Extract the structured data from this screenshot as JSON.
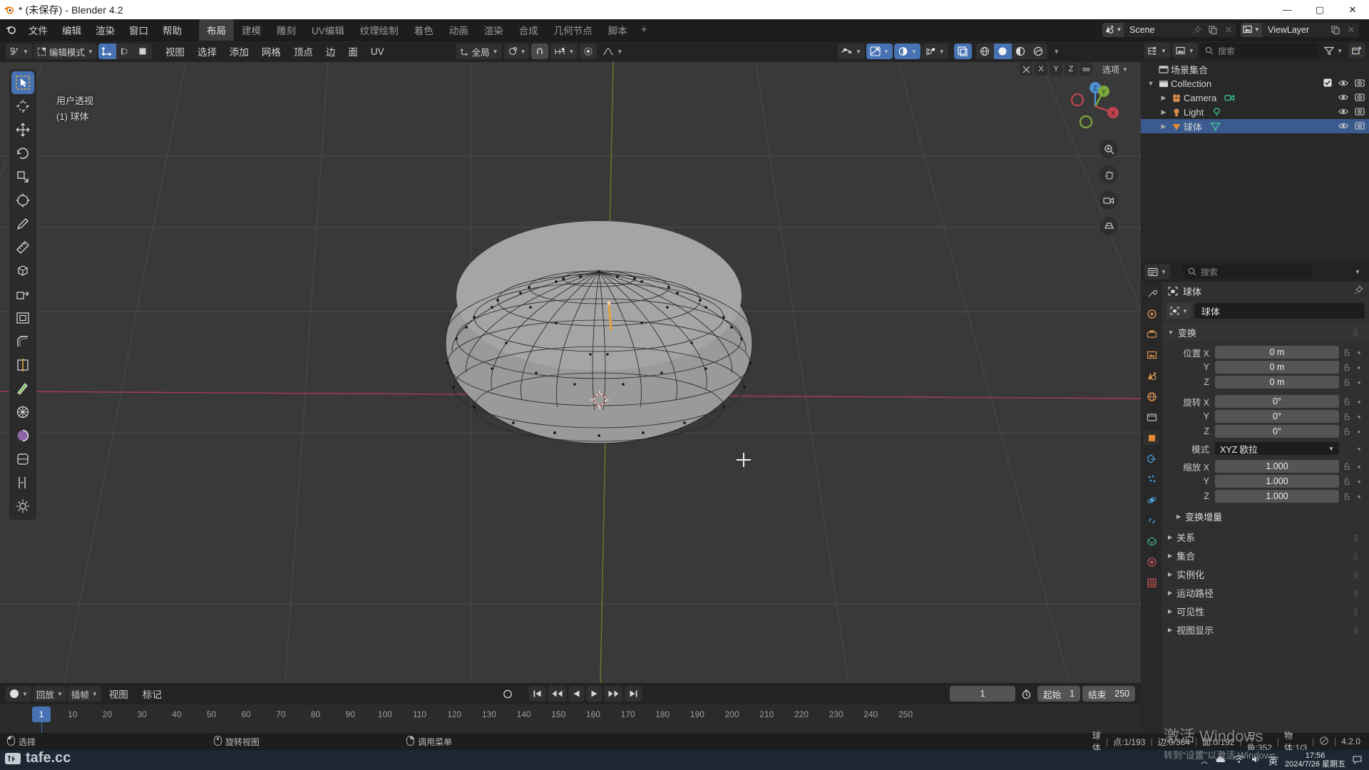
{
  "window": {
    "title": "* (未保存) - Blender 4.2",
    "minimize": "—",
    "maximize": "▢",
    "close": "✕"
  },
  "topbar": {
    "menus": [
      "文件",
      "编辑",
      "渲染",
      "窗口",
      "帮助"
    ],
    "workspaces": [
      {
        "label": "布局",
        "active": true
      },
      {
        "label": "建模",
        "active": false
      },
      {
        "label": "雕刻",
        "active": false
      },
      {
        "label": "UV编辑",
        "active": false
      },
      {
        "label": "纹理绘制",
        "active": false
      },
      {
        "label": "着色",
        "active": false
      },
      {
        "label": "动画",
        "active": false
      },
      {
        "label": "渲染",
        "active": false
      },
      {
        "label": "合成",
        "active": false
      },
      {
        "label": "几何节点",
        "active": false
      },
      {
        "label": "脚本",
        "active": false
      }
    ],
    "add_workspace": "+",
    "scene": {
      "name": "Scene",
      "icon": "scene-icon"
    },
    "view_layer": {
      "name": "ViewLayer",
      "icon": "viewlayer-icon"
    }
  },
  "viewport_header": {
    "editor_type_icon": "editor-type-icon",
    "mode": "编辑模式",
    "select_modes": [
      "vertex-select-icon",
      "edge-select-icon",
      "face-select-icon"
    ],
    "active_select_mode": 0,
    "menus": [
      "视图",
      "选择",
      "添加",
      "网格",
      "顶点",
      "边",
      "面",
      "UV"
    ],
    "transform_orientation": "全局",
    "pivot_icon": "pivot-point-icon",
    "snap_icon": "magnet-icon",
    "snap_target_icon": "snap-target-icon",
    "proportional_icon": "proportional-edit-icon",
    "falloff_icon": "falloff-curve-icon",
    "right_icons": [
      "show-gizmo-icon",
      "overlays-icon",
      "xray-icon",
      "visibility-icon",
      "shading-wireframe-icon",
      "shading-solid-icon",
      "shading-material-icon",
      "shading-rendered-icon"
    ]
  },
  "viewport": {
    "view_label": "用户透视",
    "object_label": "(1) 球体",
    "axis_gizmo": {
      "x": "X",
      "y": "Y",
      "z": "Z"
    },
    "select_mode_overlay": [
      "X",
      "Y",
      "Z",
      "选项"
    ],
    "tools": [
      {
        "name": "tweak-tool",
        "active": true
      },
      {
        "name": "cursor-tool",
        "active": false
      },
      {
        "name": "move-tool",
        "active": false
      },
      {
        "name": "rotate-tool",
        "active": false
      },
      {
        "name": "scale-tool",
        "active": false
      },
      {
        "name": "transform-tool",
        "active": false
      },
      {
        "name": "annotate-tool",
        "active": false
      },
      {
        "name": "measure-tool",
        "active": false
      },
      {
        "name": "add-cube-tool",
        "active": false
      },
      {
        "name": "extrude-region-tool",
        "active": false
      },
      {
        "name": "inset-faces-tool",
        "active": false
      },
      {
        "name": "bevel-tool",
        "active": false
      },
      {
        "name": "loop-cut-tool",
        "active": false
      },
      {
        "name": "knife-tool",
        "active": false
      },
      {
        "name": "poly-build-tool",
        "active": false
      },
      {
        "name": "spin-tool",
        "active": false
      },
      {
        "name": "smooth-tool",
        "active": false
      },
      {
        "name": "edge-slide-tool",
        "active": false
      },
      {
        "name": "shrink-fatten-tool",
        "active": false
      }
    ]
  },
  "timeline": {
    "editor_icon": "timeline-editor-icon",
    "menus": [
      "回放",
      "插帧",
      "视图",
      "标记"
    ],
    "playhead_frame": "1",
    "ticks": [
      "10",
      "20",
      "30",
      "40",
      "50",
      "60",
      "70",
      "80",
      "90",
      "100",
      "110",
      "120",
      "130",
      "140",
      "150",
      "160",
      "170",
      "180",
      "190",
      "200",
      "210",
      "220",
      "230",
      "240",
      "250"
    ],
    "current_frame": "1",
    "start_label": "起始",
    "start_value": "1",
    "end_label": "结束",
    "end_value": "250"
  },
  "outliner": {
    "display_mode_icon": "outliner-display-icon",
    "filter_icon": "filter-icon",
    "new_collection_icon": "new-collection-icon",
    "search_placeholder": "搜索",
    "root": "场景集合",
    "items": [
      {
        "label": "Collection",
        "icon": "collection-icon",
        "depth": 0,
        "expanded": true,
        "checkbox": true,
        "selected": false
      },
      {
        "label": "Camera",
        "icon": "camera-object-icon",
        "depth": 1,
        "expanded": false,
        "data_icon": "camera-data-icon",
        "selected": false
      },
      {
        "label": "Light",
        "icon": "light-object-icon",
        "depth": 1,
        "expanded": false,
        "data_icon": "light-data-icon",
        "selected": false
      },
      {
        "label": "球体",
        "icon": "mesh-object-icon",
        "depth": 1,
        "expanded": false,
        "data_icon": "mesh-data-icon",
        "selected": true
      }
    ]
  },
  "properties": {
    "editor_icon": "properties-editor-icon",
    "search_placeholder": "搜索",
    "tabs": [
      {
        "name": "tool-tab",
        "active": false
      },
      {
        "name": "render-tab",
        "active": false
      },
      {
        "name": "output-tab",
        "active": false
      },
      {
        "name": "view-layer-tab",
        "active": false
      },
      {
        "name": "scene-tab",
        "active": false
      },
      {
        "name": "world-tab",
        "active": false
      },
      {
        "name": "collection-tab",
        "active": false
      },
      {
        "name": "object-tab",
        "active": true
      },
      {
        "name": "modifier-tab",
        "active": false
      },
      {
        "name": "particles-tab",
        "active": false
      },
      {
        "name": "physics-tab",
        "active": false
      },
      {
        "name": "constraint-tab",
        "active": false
      },
      {
        "name": "data-tab",
        "active": false
      },
      {
        "name": "material-tab",
        "active": false
      },
      {
        "name": "texture-tab",
        "active": false
      }
    ],
    "breadcrumb": "球体",
    "pin_icon": "pin-icon",
    "id_name": "球体",
    "transform_panel": {
      "title": "变换",
      "rows": [
        {
          "label": "位置 X",
          "value": "0 m"
        },
        {
          "label": "Y",
          "value": "0 m"
        },
        {
          "label": "Z",
          "value": "0 m"
        },
        {
          "label": "旋转 X",
          "value": "0°"
        },
        {
          "label": "Y",
          "value": "0°"
        },
        {
          "label": "Z",
          "value": "0°"
        }
      ],
      "mode_label": "模式",
      "mode_value": "XYZ 欧拉",
      "scale_rows": [
        {
          "label": "缩放 X",
          "value": "1.000"
        },
        {
          "label": "Y",
          "value": "1.000"
        },
        {
          "label": "Z",
          "value": "1.000"
        }
      ],
      "delta_transform": "变换增量"
    },
    "sections": [
      "关系",
      "集合",
      "实例化",
      "运动路径",
      "可见性",
      "视图显示"
    ]
  },
  "statusbar": {
    "hints": [
      {
        "icon": "mouse-left-icon",
        "label": "选择"
      },
      {
        "icon": "mouse-middle-icon",
        "label": "旋转视图"
      },
      {
        "icon": "mouse-right-icon",
        "label": "调用菜单"
      }
    ],
    "stats": [
      "球体",
      "点:1/193",
      "边:0/384",
      "面:0/192",
      "三角:352",
      "物体:1/3"
    ],
    "version": "4.2.0"
  },
  "watermark": {
    "line1": "激活 Windows",
    "line2": "转到\"设置\"以激活 Windows。"
  },
  "sitemark": "tafe.cc",
  "taskbar": {
    "ime": "英",
    "time": "17:56",
    "date": "2024/7/26 星期五"
  },
  "colors": {
    "accent": "#4772b3",
    "viewport_bg": "#393939",
    "axis_x": "#cc3355",
    "axis_y": "#8caa2c",
    "selected_row": "#3b5b8f"
  }
}
